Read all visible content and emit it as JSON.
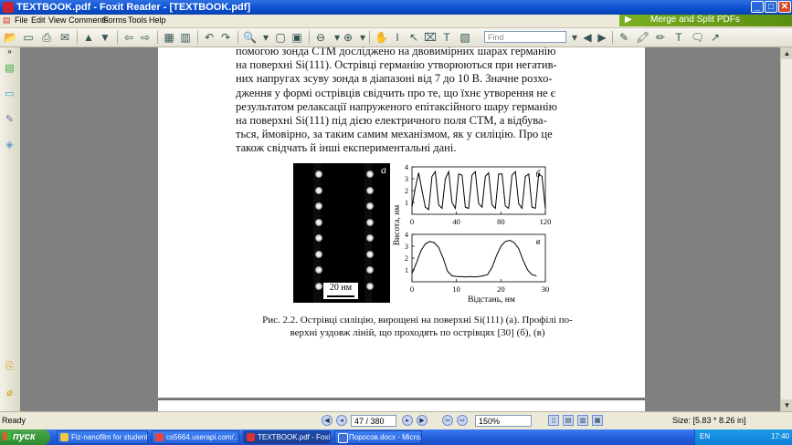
{
  "window": {
    "title": "TEXTBOOK.pdf - Foxit Reader - [TEXTBOOK.pdf]"
  },
  "menu": [
    "File",
    "Edit",
    "View",
    "Comments",
    "Forms",
    "Tools",
    "Help"
  ],
  "promo": {
    "label": "Merge and Split PDFs"
  },
  "toolbar": {
    "find_placeholder": "Find"
  },
  "document": {
    "paragraph": [
      "помогою зонда СТМ досліджено на двовимірних шарах германію",
      "на поверхні Si(111). Острівці германію утворюються при негатив-",
      "них напругах зсуву зонда в діапазоні від 7 до 10 В. Значне розхо-",
      "дження у формі острівців свідчить про те, що їхнє утворення не є",
      "результатом релаксації напруженого епітаксійного шару германію",
      "на поверхні Si(111) під дією електричного поля СТМ, а відбува-",
      "ться, ймовірно, за таким самим механізмом, як у силіцію. Про це",
      "також свідчать й інші експериментальні дані."
    ],
    "figure": {
      "image_label": "а",
      "scale_label": "20 нм",
      "caption_lines": [
        "Рис. 2.2. Острівці силіцію, вирощені на поверхні Si(111) (а). Профілі по-",
        "верхні уздовж ліній, що проходять по острівцях [30] (б), (в)"
      ]
    }
  },
  "chart_data": [
    {
      "type": "line",
      "panel_label": "б",
      "ylabel": "Висота, нм",
      "xlabel": "",
      "xlim": [
        0,
        120
      ],
      "ylim": [
        0,
        4
      ],
      "xticks": [
        0,
        40,
        80,
        120
      ],
      "yticks": [
        1,
        2,
        3,
        4
      ],
      "x": [
        0,
        3,
        6,
        9,
        12,
        15,
        18,
        21,
        24,
        27,
        30,
        33,
        36,
        39,
        42,
        45,
        48,
        51,
        54,
        57,
        60,
        63,
        66,
        69,
        72,
        75,
        78,
        81,
        84,
        87,
        90,
        93,
        96,
        99,
        102,
        105,
        108,
        111,
        114,
        117,
        120
      ],
      "values": [
        0.6,
        2.2,
        3.5,
        2.0,
        0.6,
        0.4,
        3.2,
        3.6,
        0.8,
        0.5,
        3.0,
        3.6,
        1.0,
        0.5,
        3.4,
        3.3,
        0.6,
        0.5,
        3.3,
        3.6,
        0.9,
        0.6,
        3.2,
        3.5,
        0.8,
        0.5,
        3.4,
        3.4,
        0.7,
        0.5,
        3.3,
        3.6,
        0.9,
        0.5,
        3.2,
        3.4,
        0.6,
        0.5,
        3.4,
        3.2,
        0.5
      ]
    },
    {
      "type": "line",
      "panel_label": "в",
      "ylabel": "Висота, нм",
      "xlabel": "Відстань, нм",
      "xlim": [
        0,
        30
      ],
      "ylim": [
        0,
        4
      ],
      "xticks": [
        0,
        10,
        20,
        30
      ],
      "yticks": [
        1,
        2,
        3,
        4
      ],
      "x": [
        0,
        1,
        2,
        3,
        4,
        5,
        6,
        7,
        8,
        9,
        10,
        11,
        12,
        13,
        14,
        15,
        16,
        17,
        18,
        19,
        20,
        21,
        22,
        23,
        24,
        25,
        26,
        27,
        28
      ],
      "values": [
        0.7,
        1.6,
        2.6,
        3.2,
        3.4,
        3.3,
        2.9,
        2.0,
        0.9,
        0.5,
        0.45,
        0.45,
        0.4,
        0.45,
        0.4,
        0.45,
        0.5,
        0.6,
        1.2,
        2.2,
        3.0,
        3.4,
        3.5,
        3.3,
        2.8,
        1.8,
        1.0,
        0.6,
        0.5
      ]
    }
  ],
  "status": {
    "ready": "Ready",
    "page": "47 / 380",
    "zoom": "150%",
    "page_size": "Size: [5.83 * 8.26 in]"
  },
  "taskbar": {
    "start": "пуск",
    "tasks": [
      "Fiz-nanofilm for student",
      "cs5664.userapi.com/...",
      "TEXTBOOK.pdf - Foxit...",
      "Поросов.docx - Micro..."
    ],
    "lang": "EN",
    "clock": "17:40"
  },
  "colors": {
    "titlebar": "#0a4fd0",
    "taskbar": "#245edc",
    "promo": "#6ea01a",
    "start": "#3a993a"
  }
}
